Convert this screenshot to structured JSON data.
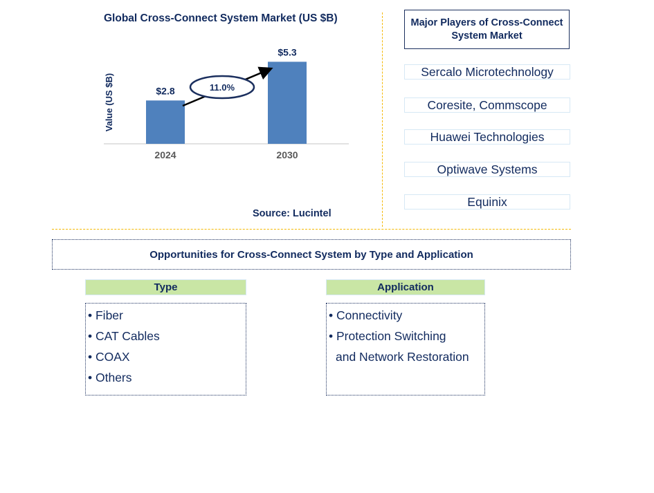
{
  "chart_data": {
    "type": "bar",
    "title": "Global Cross-Connect System Market (US $B)",
    "xlabel": "",
    "ylabel": "Value (US $B)",
    "categories": [
      "2024",
      "2030"
    ],
    "values": [
      2.8,
      5.3
    ],
    "data_labels": [
      "$2.8",
      "$5.3"
    ],
    "ylim": [
      0,
      6
    ],
    "grid": false,
    "bar_color": "#4f81bd",
    "annotation": {
      "type": "cagr-arrow",
      "label": "11.0%",
      "from": "2024",
      "to": "2030"
    },
    "source": "Source: Lucintel"
  },
  "players": {
    "title": "Major Players of Cross-Connect System Market",
    "items": [
      "Sercalo Microtechnology",
      "Coresite, Commscope",
      "Huawei Technologies",
      "Optiwave Systems",
      "Equinix"
    ]
  },
  "opportunities": {
    "title": "Opportunities for Cross-Connect System by Type and Application",
    "type": {
      "heading": "Type",
      "items": [
        "• Fiber",
        "• CAT Cables",
        "• COAX",
        "• Others"
      ]
    },
    "application": {
      "heading": "Application",
      "items": [
        "• Connectivity",
        "• Protection Switching",
        "and Network Restoration"
      ]
    }
  },
  "colors": {
    "navy": "#112a5e",
    "divider": "#f5b800",
    "segment_header": "#c9e6a5",
    "player_border": "#d6e8f5"
  }
}
